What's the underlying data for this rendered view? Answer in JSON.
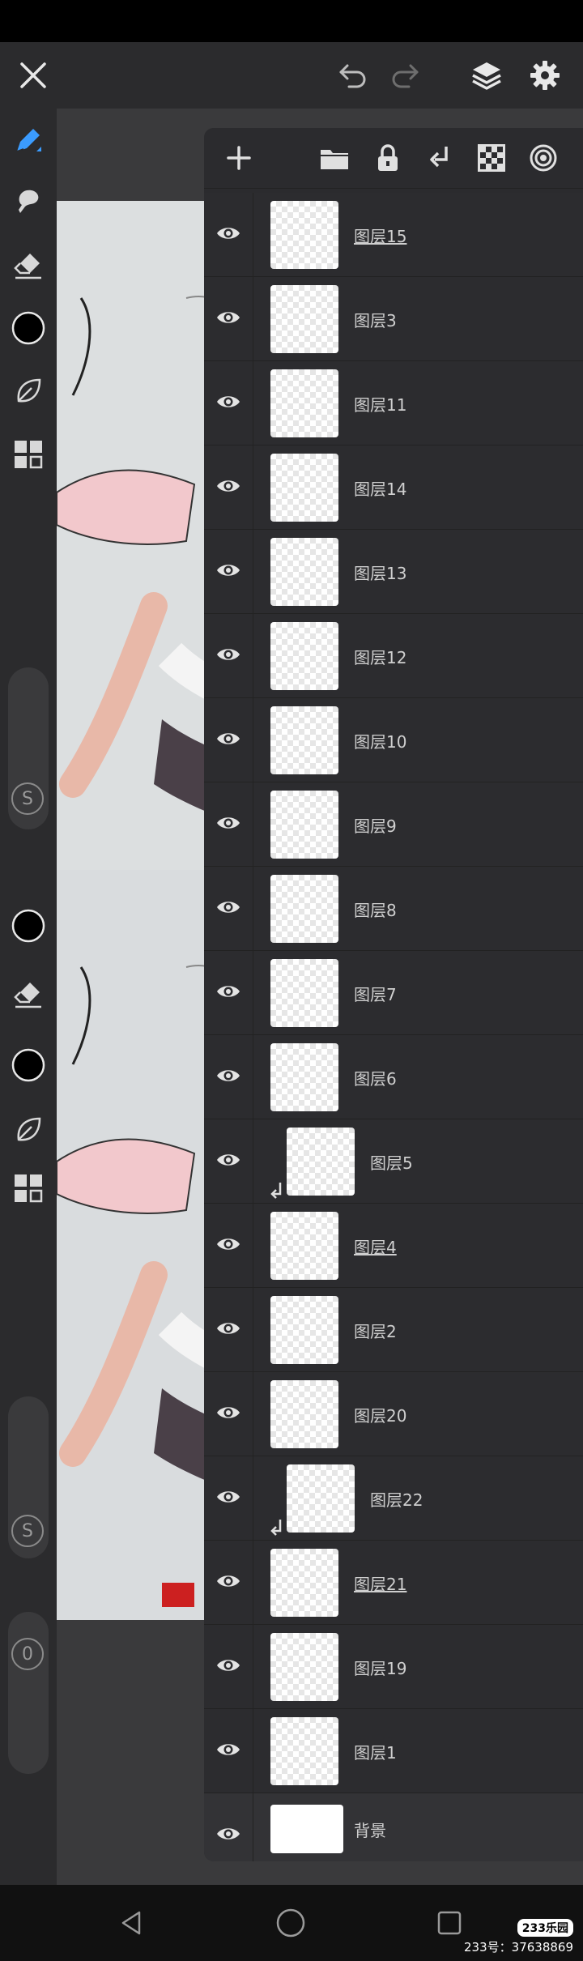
{
  "layers": [
    {
      "name": "图层15",
      "underlined": true,
      "clipped": false
    },
    {
      "name": "图层3",
      "underlined": false,
      "clipped": false
    },
    {
      "name": "图层11",
      "underlined": false,
      "clipped": false
    },
    {
      "name": "图层14",
      "underlined": false,
      "clipped": false
    },
    {
      "name": "图层13",
      "underlined": false,
      "clipped": false
    },
    {
      "name": "图层12",
      "underlined": false,
      "clipped": false
    },
    {
      "name": "图层10",
      "underlined": false,
      "clipped": false
    },
    {
      "name": "图层9",
      "underlined": false,
      "clipped": false
    },
    {
      "name": "图层8",
      "underlined": false,
      "clipped": false
    },
    {
      "name": "图层7",
      "underlined": false,
      "clipped": false
    },
    {
      "name": "图层6",
      "underlined": false,
      "clipped": false
    },
    {
      "name": "图层5",
      "underlined": false,
      "clipped": true
    },
    {
      "name": "图层4",
      "underlined": true,
      "clipped": false
    },
    {
      "name": "图层2",
      "underlined": false,
      "clipped": false
    },
    {
      "name": "图层20",
      "underlined": false,
      "clipped": false
    },
    {
      "name": "图层22",
      "underlined": false,
      "clipped": true
    },
    {
      "name": "图层21",
      "underlined": true,
      "clipped": false
    },
    {
      "name": "图层19",
      "underlined": false,
      "clipped": false
    },
    {
      "name": "图层1",
      "underlined": false,
      "clipped": false
    },
    {
      "name": "背景",
      "underlined": false,
      "clipped": false
    }
  ],
  "left_toolbar": {
    "size_badge_1": "S",
    "size_badge_2": "S",
    "opacity_badge": "0"
  },
  "watermark": {
    "badge": "233乐园",
    "id_text": "233号：37638869"
  },
  "colors": {
    "accent": "#3b9cff",
    "panel_bg": "#2b2b2e",
    "toolbar_bg": "#2b2b2d"
  },
  "icons": [
    "close-icon",
    "undo-icon",
    "redo-icon",
    "layers-icon",
    "settings-icon",
    "pen-tool-icon",
    "smudge-icon",
    "eraser-icon",
    "color-swatch-icon",
    "leaf-icon",
    "grid-icon",
    "add-layer-icon",
    "folder-icon",
    "lock-icon",
    "merge-down-icon",
    "checkerboard-icon",
    "blend-mode-icon",
    "eye-icon",
    "back-icon",
    "home-icon",
    "recents-icon"
  ]
}
